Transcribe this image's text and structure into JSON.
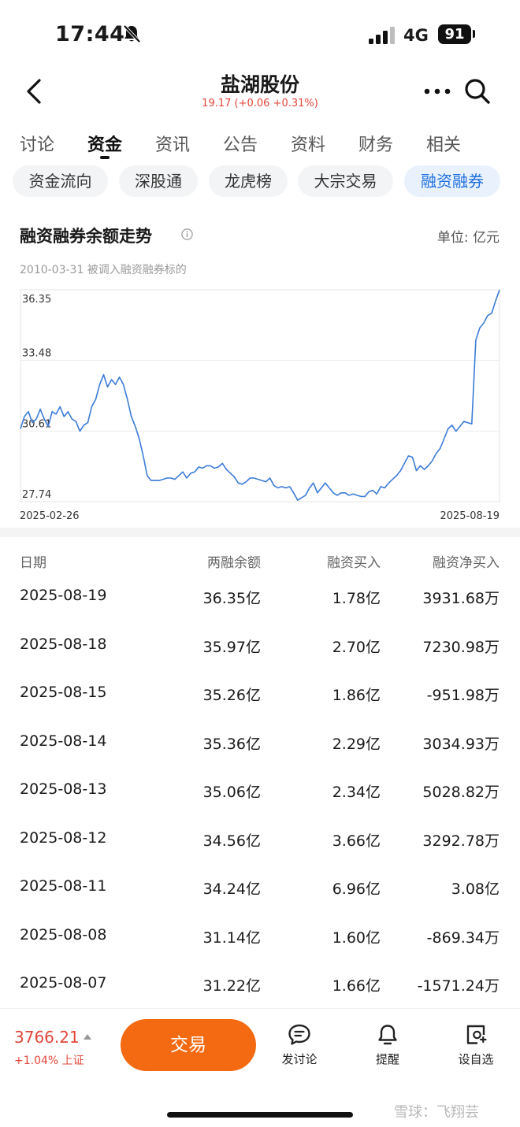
{
  "status_bar": {
    "time": "17:44",
    "network": "4G",
    "battery": "91"
  },
  "header": {
    "title": "盐湖股份",
    "quote": "19.17 (+0.06 +0.31%)"
  },
  "tabs": [
    {
      "label": "讨论"
    },
    {
      "label": "资金"
    },
    {
      "label": "资讯"
    },
    {
      "label": "公告"
    },
    {
      "label": "资料"
    },
    {
      "label": "财务"
    },
    {
      "label": "相关"
    }
  ],
  "active_tab": "资金",
  "chips": [
    {
      "label": "资金流向"
    },
    {
      "label": "深股通"
    },
    {
      "label": "龙虎榜"
    },
    {
      "label": "大宗交易"
    },
    {
      "label": "融资融券"
    }
  ],
  "active_chip": "融资融券",
  "chart_section": {
    "title": "融资融券余额走势",
    "unit": "单位: 亿元",
    "note": "2010-03-31 被调入融资融券标的"
  },
  "chart_data": {
    "type": "line",
    "title": "融资融券余额走势",
    "y_ticks": [
      "36.35",
      "33.48",
      "30.61",
      "27.74"
    ],
    "ylim": [
      27.74,
      36.35
    ],
    "x_labels": [
      "2025-02-26",
      "2025-08-19"
    ],
    "grid": true,
    "color": "#3b7bd6",
    "values": [
      30.7,
      31.2,
      31.4,
      30.95,
      31.1,
      31.5,
      31.1,
      30.8,
      31.4,
      31.3,
      31.6,
      31.2,
      31.4,
      31.1,
      31.0,
      30.6,
      30.85,
      30.95,
      31.6,
      31.9,
      32.5,
      32.9,
      32.4,
      32.7,
      32.5,
      32.8,
      32.5,
      31.9,
      31.2,
      30.8,
      30.3,
      29.6,
      28.8,
      28.6,
      28.6,
      28.6,
      28.65,
      28.7,
      28.7,
      28.65,
      28.8,
      28.95,
      28.7,
      28.9,
      28.95,
      29.15,
      29.1,
      29.2,
      29.2,
      29.1,
      29.15,
      29.3,
      29.05,
      28.9,
      28.75,
      28.5,
      28.45,
      28.55,
      28.7,
      28.7,
      28.65,
      28.6,
      28.55,
      28.7,
      28.4,
      28.3,
      28.35,
      28.3,
      28.35,
      28.1,
      27.8,
      27.9,
      28.0,
      28.3,
      28.5,
      28.1,
      28.3,
      28.5,
      28.3,
      28.1,
      28.0,
      28.1,
      28.1,
      28.0,
      28.05,
      28.0,
      27.95,
      27.95,
      28.15,
      28.2,
      28.05,
      28.35,
      28.3,
      28.5,
      28.65,
      28.8,
      29.0,
      29.3,
      29.6,
      29.55,
      29.0,
      29.2,
      29.05,
      29.2,
      29.4,
      29.7,
      29.9,
      30.3,
      30.7,
      30.85,
      30.6,
      30.8,
      31.0,
      30.95,
      30.9,
      34.3,
      34.8,
      35.0,
      35.3,
      35.4,
      35.9,
      36.35
    ]
  },
  "table": {
    "headers": [
      "日期",
      "两融余额",
      "融资买入",
      "融资净买入"
    ],
    "rows": [
      [
        "2025-08-19",
        "36.35亿",
        "1.78亿",
        "3931.68万"
      ],
      [
        "2025-08-18",
        "35.97亿",
        "2.70亿",
        "7230.98万"
      ],
      [
        "2025-08-15",
        "35.26亿",
        "1.86亿",
        "-951.98万"
      ],
      [
        "2025-08-14",
        "35.36亿",
        "2.29亿",
        "3034.93万"
      ],
      [
        "2025-08-13",
        "35.06亿",
        "2.34亿",
        "5028.82万"
      ],
      [
        "2025-08-12",
        "34.56亿",
        "3.66亿",
        "3292.78万"
      ],
      [
        "2025-08-11",
        "34.24亿",
        "6.96亿",
        "3.08亿"
      ],
      [
        "2025-08-08",
        "31.14亿",
        "1.60亿",
        "-869.34万"
      ],
      [
        "2025-08-07",
        "31.22亿",
        "1.66亿",
        "-1571.24万"
      ]
    ]
  },
  "bottom_bar": {
    "index_value": "3766.21",
    "index_change": "+1.04% 上证",
    "trade_label": "交易",
    "nav": [
      {
        "label": "发讨论"
      },
      {
        "label": "提醒"
      },
      {
        "label": "设自选"
      }
    ]
  },
  "watermark": "雪球：飞翔芸"
}
